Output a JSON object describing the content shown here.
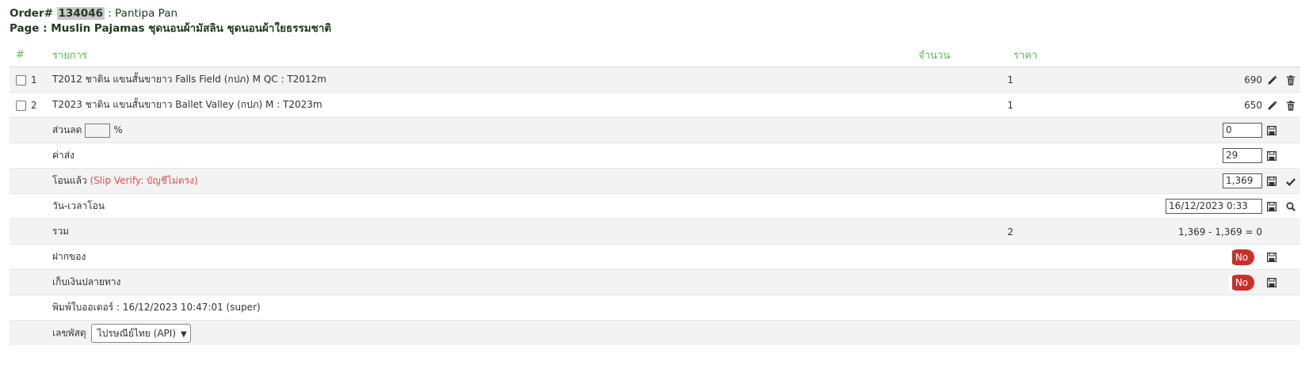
{
  "header": {
    "order_prefix": "Order# ",
    "order_id": "134046",
    "customer": " : Pantipa Pan",
    "page_line": "Page : Muslin Pajamas ชุดนอนผ้ามัสลิน ชุดนอนผ้าใยธรรมชาติ"
  },
  "columns": {
    "num": "#",
    "item": "รายการ",
    "qty": "จำนวน",
    "price": "ราคา"
  },
  "items": [
    {
      "num": "1",
      "name": "T2012 ชาติน แขนสั้นขายาว Falls Field (กปภ) M QC : T2012m",
      "qty": "1",
      "price": "690"
    },
    {
      "num": "2",
      "name": "T2023 ชาติน แขนสั้นขายาว Ballet Valley (กปภ) M : T2023m",
      "qty": "1",
      "price": "650"
    }
  ],
  "discount": {
    "label": "ส่วนลด",
    "percent_sign": "%",
    "value": "0"
  },
  "shipping": {
    "label": "ค่าส่ง",
    "value": "29"
  },
  "paid": {
    "label": "โอนแล้ว",
    "note": " (Slip Verify: บัญชีไม่ตรง)",
    "value": "1,369"
  },
  "transfer_time": {
    "label": "วัน-เวลาโอน",
    "value": "16/12/2023 0:33"
  },
  "total": {
    "label": "รวม",
    "qty": "2",
    "value": "1,369 - 1,369 = 0"
  },
  "deposit": {
    "label": "ฝากของ",
    "toggle": "No"
  },
  "cod": {
    "label": "เก็บเงินปลายทาง",
    "toggle": "No"
  },
  "printed": {
    "text": "พิมพ์ใบออเดอร์ : 16/12/2023 10:47:01 (super)"
  },
  "tracking": {
    "label": "เลขพัสดุ",
    "carrier": "ไปรษณีย์ไทย (API)"
  },
  "colors": {
    "accent_green": "#5cb85c",
    "toggle_red": "#c9302c",
    "warning_red": "#d9534f"
  }
}
